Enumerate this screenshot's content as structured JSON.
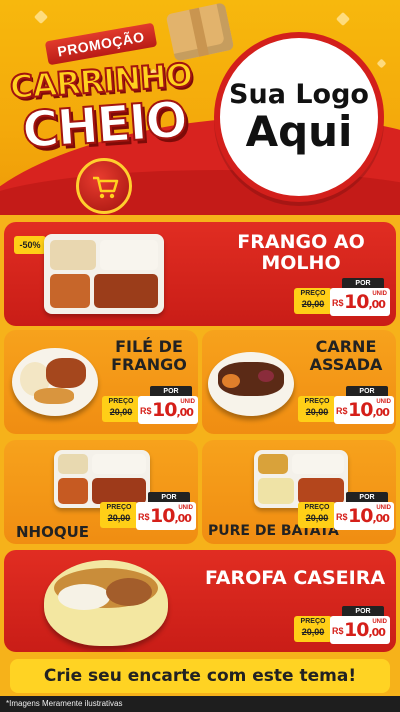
{
  "header": {
    "promo_label": "PROMOÇÃO",
    "title_line1": "CARRINHO",
    "title_line2": "CHEIO",
    "logo_line1": "Sua Logo",
    "logo_line2": "Aqui"
  },
  "colors": {
    "brand_red": "#d31f1b",
    "brand_yellow": "#ffcf17",
    "orange": "#f7a21c"
  },
  "products": [
    {
      "title_l1": "FRANGO AO",
      "title_l2": "MOLHO",
      "tag": "-50%",
      "preco_label": "PREÇO",
      "old_price": "20,00",
      "por_label": "POR",
      "currency": "R$",
      "new_price_int": "10",
      "new_price_dec": ",00",
      "unit": "UNID"
    },
    {
      "title_l1": "FILÉ DE",
      "title_l2": "FRANGO",
      "preco_label": "PREÇO",
      "old_price": "20,00",
      "por_label": "POR",
      "currency": "R$",
      "new_price_int": "10",
      "new_price_dec": ",00",
      "unit": "UNID"
    },
    {
      "title_l1": "CARNE",
      "title_l2": "ASSADA",
      "preco_label": "PREÇO",
      "old_price": "20,00",
      "por_label": "POR",
      "currency": "R$",
      "new_price_int": "10",
      "new_price_dec": ",00",
      "unit": "UNID"
    },
    {
      "title_l1": "NHOQUE",
      "preco_label": "PREÇO",
      "old_price": "20,00",
      "por_label": "POR",
      "currency": "R$",
      "new_price_int": "10",
      "new_price_dec": ",00",
      "unit": "UNID"
    },
    {
      "title_l1": "PURE DE BATATA",
      "preco_label": "PREÇO",
      "old_price": "20,00",
      "por_label": "POR",
      "currency": "R$",
      "new_price_int": "10",
      "new_price_dec": ",00",
      "unit": "UNID"
    },
    {
      "title_l1": "FAROFA CASEIRA",
      "preco_label": "PREÇO",
      "old_price": "20,00",
      "por_label": "POR",
      "currency": "R$",
      "new_price_int": "10",
      "new_price_dec": ",00",
      "unit": "UNID"
    }
  ],
  "footer": {
    "cta": "Crie seu encarte com este tema!",
    "disclaimer": "*Imagens Meramente ilustrativas"
  }
}
